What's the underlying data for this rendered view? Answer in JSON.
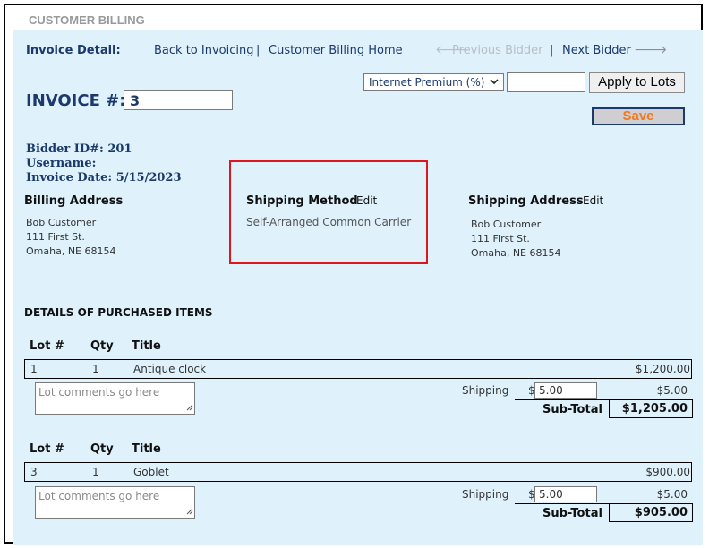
{
  "header": {
    "title": "CUSTOMER BILLING"
  },
  "nav": {
    "label": "Invoice Detail:",
    "back_link": "Back to Invoicing",
    "separator": "|",
    "home_link": "Customer Billing Home",
    "prev_arrow": "🡐",
    "prev_bidder": "Previous Bidder",
    "next_bidder": "Next Bidder",
    "next_arrow": "🡒"
  },
  "premium": {
    "select_value": "Internet Premium (%)",
    "percent_value": "",
    "apply_label": "Apply to Lots"
  },
  "save_label": "Save",
  "invoice": {
    "label": "INVOICE #:",
    "number": "3"
  },
  "bidder": {
    "id_line": "Bidder ID#: 201",
    "username_line": "Username:",
    "date_line": "Invoice Date: 5/15/2023"
  },
  "billing_address": {
    "heading": "Billing Address",
    "lines": [
      "Bob Customer",
      "111 First St.",
      "Omaha, NE 68154"
    ]
  },
  "shipping_method": {
    "heading": "Shipping Method",
    "edit_label": "Edit",
    "value": "Self-Arranged Common Carrier"
  },
  "shipping_address": {
    "heading": "Shipping Address",
    "edit_label": "Edit",
    "lines": [
      "Bob Customer",
      "111 First St.",
      "Omaha, NE 68154"
    ]
  },
  "items": {
    "heading": "DETAILS OF PURCHASED ITEMS",
    "columns": [
      "Lot #",
      "Qty",
      "Title"
    ],
    "comment_placeholder": "Lot comments go here",
    "shipping_label": "Shipping",
    "currency_symbol": "$",
    "subtotal_label": "Sub-Total",
    "rows": [
      {
        "lot": "1",
        "qty": "1",
        "title": "Antique clock",
        "price": "$1,200.00",
        "shipping_input": "5.00",
        "shipping_amount": "$5.00",
        "subtotal": "$1,205.00"
      },
      {
        "lot": "3",
        "qty": "1",
        "title": "Goblet",
        "price": "$900.00",
        "shipping_input": "5.00",
        "shipping_amount": "$5.00",
        "subtotal": "$905.00"
      }
    ]
  },
  "colors": {
    "panel_bg": "#dff2fc",
    "navy_text": "#1b3a6b",
    "save_text": "#f07a1d",
    "highlight_border": "#e0161e"
  }
}
